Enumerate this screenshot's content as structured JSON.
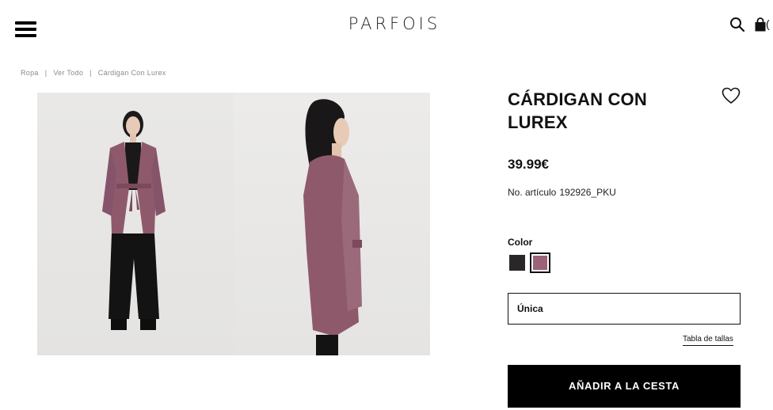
{
  "header": {
    "logo": "PARFOIS",
    "bag_count": "(",
    "icons": {
      "menu": "hamburger-menu-icon",
      "search": "search-icon",
      "bag": "shopping-bag-icon"
    }
  },
  "breadcrumb": {
    "items": [
      "Ropa",
      "Ver Todo",
      "Cárdigan Con Lurex"
    ],
    "separator": "|"
  },
  "product": {
    "title": "CÁRDIGAN CON LUREX",
    "price": "39.99€",
    "ref_label": "No. artículo",
    "ref_value": "192926_PKU",
    "color_label": "Color",
    "swatches": [
      {
        "name": "black",
        "color": "#2b2728"
      },
      {
        "name": "pink",
        "color": "#9c6277"
      }
    ],
    "size_value": "Única",
    "size_guide": "Tabla de tallas",
    "add_to_cart": "AÑADIR A LA CESTA",
    "wishlist_icon": "heart-icon"
  },
  "colors": {
    "cardigan": "#8e5a6b",
    "button_bg": "#000000",
    "text": "#111111"
  }
}
